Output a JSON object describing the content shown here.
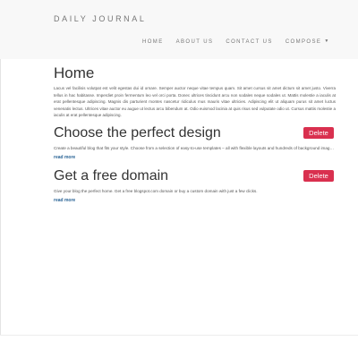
{
  "navbar": {
    "brand": "DAILY JOURNAL",
    "links": [
      "HOME",
      "ABOUT US",
      "CONTACT US"
    ],
    "compose": "COMPOSE",
    "compose_caret": "▼"
  },
  "home": {
    "title": "Home",
    "text": "Lacus vel facilisis volutpat est velit egestas dui id ornare. Semper auctor neque vitae tempus quam. Sit amet cursus sit amet dictum sit amet justo. Viverra tellus in hac habitasse. Imperdiet proin fermentum leo vel orci porta. Donec ultrices tincidunt arcu non sodales neque sodales ut. Mattis molestie a iaculis at erat pellentesque adipiscing. Magnis dis parturient montes nascetur ridiculus mus mauris vitae ultricies. Adipiscing elit ut aliquam purus sit amet luctus venenatis lectus. Ultrices vitae auctor eu augue ut lectus arcu bibendum at. Odio euismod lacinia at quis risus sed vulputate odio ut. Cursus mattis molestie a iaculis at erat pellentesque adipiscing."
  },
  "posts": [
    {
      "title": "Choose the perfect design",
      "text": "Create a beautiful blog that fits your style. Choose from a selection of easy-to-use templates – all with flexible layouts and hundreds of background images – or design something new.",
      "read_more": "read more",
      "delete": "Delete"
    },
    {
      "title": "Get a free domain",
      "text": "Give your blog the perfect home. Get a free blogspot.com domain or buy a custom domain with just a few clicks.",
      "read_more": "read more",
      "delete": "Delete"
    }
  ],
  "colors": {
    "navbar_bg": "#f8f8f8",
    "delete_bg": "#d9304f",
    "link": "#2a6496"
  }
}
